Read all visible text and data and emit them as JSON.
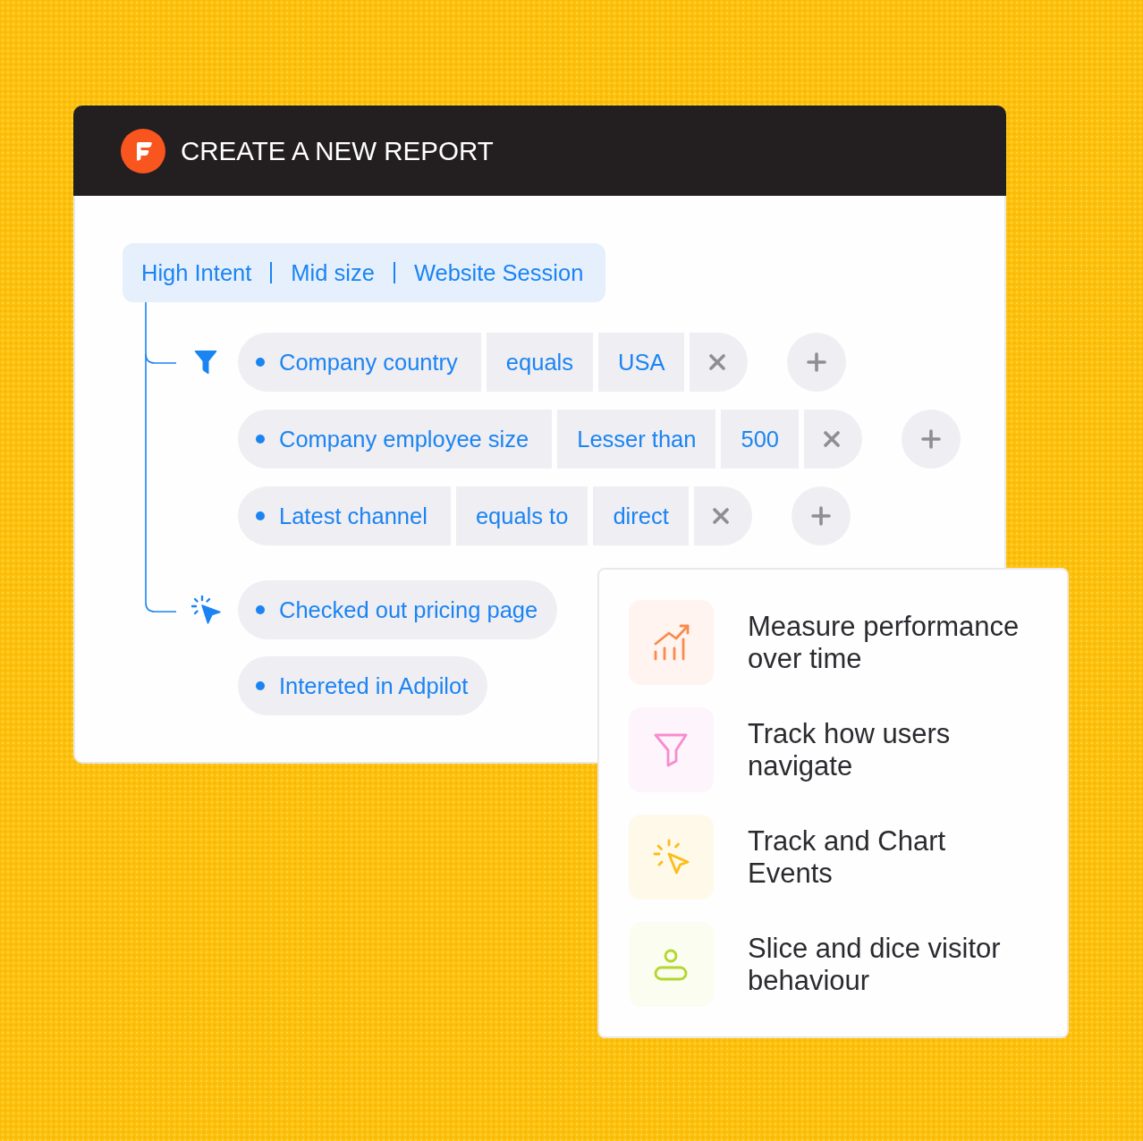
{
  "header": {
    "title": "CREATE A NEW REPORT"
  },
  "segments": [
    "High Intent",
    "Mid size",
    "Website Session"
  ],
  "groups": [
    {
      "kind": "filter",
      "conditions": [
        {
          "field": "Company country",
          "operator": "equals",
          "value": "USA"
        },
        {
          "field": "Company employee size",
          "operator": "Lesser than",
          "value": "500"
        },
        {
          "field": "Latest channel",
          "operator": "equals to",
          "value": "direct"
        }
      ]
    },
    {
      "kind": "event",
      "events": [
        "Checked out pricing page",
        "Intereted in Adpilot"
      ]
    }
  ],
  "features": [
    {
      "kind": "trend",
      "text": "Measure performance over time"
    },
    {
      "kind": "funnel",
      "text": "Track how users navigate"
    },
    {
      "kind": "click",
      "text": "Track and Chart Events"
    },
    {
      "kind": "person",
      "text": "Slice and dice visitor behaviour"
    }
  ]
}
